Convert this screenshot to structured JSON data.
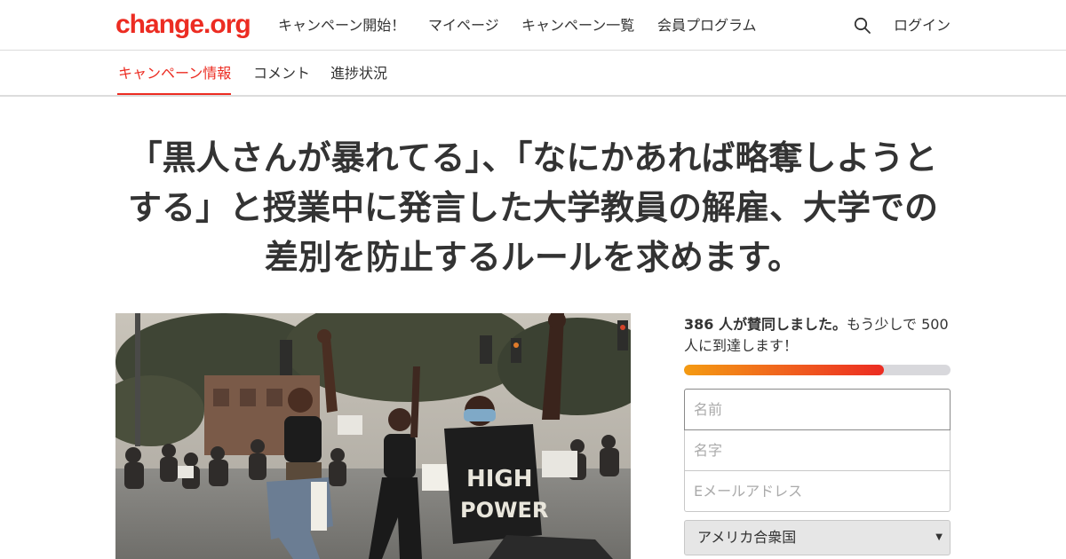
{
  "header": {
    "logo": "change.org",
    "nav": [
      "キャンペーン開始！",
      "マイページ",
      "キャンペーン一覧",
      "会員プログラム"
    ],
    "login": "ログイン"
  },
  "tabs": [
    "キャンペーン情報",
    "コメント",
    "進捗状況"
  ],
  "petition": {
    "title": "「黒人さんが暴れてる」、「なにかあれば略奪しようとする」と授業中に発言した大学教員の解雇、大学での差別を防止するルールを求めます。"
  },
  "signatures": {
    "count_text": "386 人が賛同しました。",
    "goal_text": "もう少しで 500 人に到達します！",
    "progress_fraction": 0.75
  },
  "form": {
    "first_name_placeholder": "名前",
    "last_name_placeholder": "名字",
    "email_placeholder": "Eメールアドレス",
    "country_selected": "アメリカ合衆国"
  },
  "colors": {
    "brand": "#ec2c22",
    "progress_start": "#f49b12",
    "progress_end": "#ec2c22"
  }
}
